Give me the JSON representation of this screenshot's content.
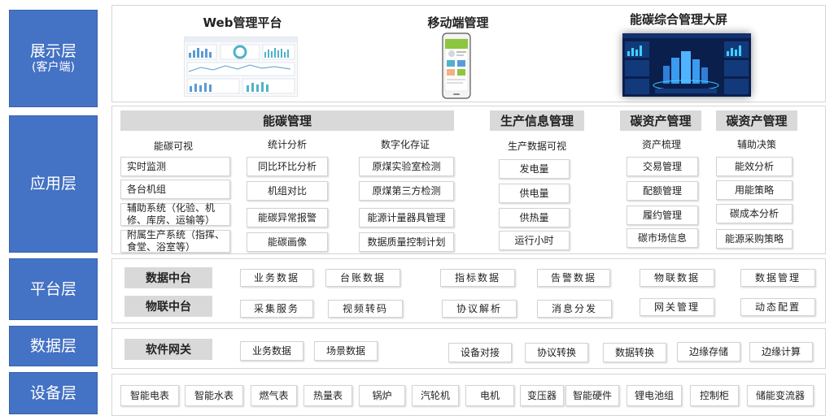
{
  "layers": {
    "presentation": {
      "name": "展示层",
      "sub": "(客户端)"
    },
    "application": {
      "name": "应用层"
    },
    "platform": {
      "name": "平台层"
    },
    "data": {
      "name": "数据层"
    },
    "device": {
      "name": "设备层"
    }
  },
  "presentation": {
    "web": "Web管理平台",
    "mobile": "移动端管理",
    "screen": "能碳综合管理大屏"
  },
  "application": {
    "energy_title": "能碳管理",
    "production_title": "生产信息管理",
    "carbon_title": "碳资产管理",
    "carbon_title2": "碳资产管理",
    "columns": [
      {
        "head": "能碳可视",
        "items": [
          "实时监测",
          "各台机组",
          "辅助系统（化验、机修、库房、运输等）",
          "附属生产系统（指挥、食堂、浴室等）"
        ]
      },
      {
        "head": "统计分析",
        "items": [
          "同比环比分析",
          "机组对比",
          "能碳异常报警",
          "能碳画像"
        ]
      },
      {
        "head": "数字化存证",
        "items": [
          "原煤实验室检测",
          "原煤第三方检测",
          "能源计量器具管理",
          "数据质量控制计划"
        ]
      },
      {
        "head": "生产数据可视",
        "items": [
          "发电量",
          "供电量",
          "供热量",
          "运行小时"
        ]
      },
      {
        "head": "资产梳理",
        "items": [
          "交易管理",
          "配额管理",
          "履约管理",
          "碳市场信息"
        ]
      },
      {
        "head": "辅助决策",
        "items": [
          "能效分析",
          "用能策略",
          "碳成本分析",
          "能源采购策略"
        ]
      }
    ]
  },
  "platform": {
    "data_hub": "数据中台",
    "iot_hub": "物联中台",
    "row1": [
      "业务数据",
      "台账数据",
      "指标数据",
      "告警数据",
      "物联数据",
      "数据管理"
    ],
    "row2": [
      "采集服务",
      "视频转码",
      "协议解析",
      "消息分发",
      "网关管理",
      "动态配置"
    ]
  },
  "data_layer": {
    "gateway": "软件网关",
    "items": [
      "业务数据",
      "场景数据",
      "设备对接",
      "协议转换",
      "数据转换",
      "边缘存储",
      "边缘计算"
    ]
  },
  "device_layer": {
    "items": [
      "智能电表",
      "智能水表",
      "燃气表",
      "热量表",
      "锅炉",
      "汽轮机",
      "电机",
      "变压器",
      "智能硬件",
      "锂电池组",
      "控制柜",
      "储能变流器"
    ]
  },
  "colors": {
    "layer_blue": "#4472c4",
    "bar_gray": "#d9d9d9",
    "screen_dark": "#0b1f4d"
  }
}
